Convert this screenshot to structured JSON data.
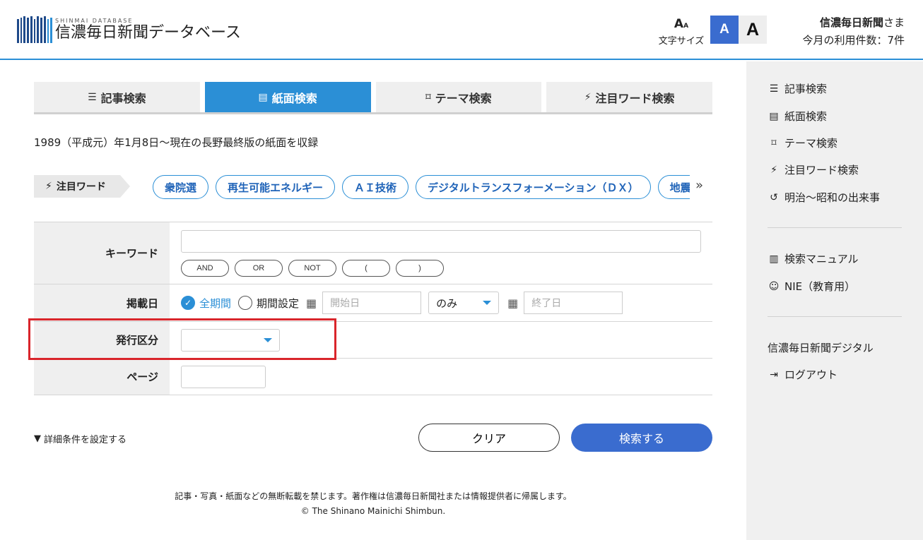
{
  "header": {
    "logo_sub": "SHINMAI DATABASE",
    "logo_main": "信濃毎日新聞データベース",
    "font_size_label": "文字サイズ",
    "font_small": "A",
    "font_large": "A",
    "user_name": "信濃毎日新聞",
    "user_suffix": "さま",
    "usage": "今月の利用件数：7件"
  },
  "tabs": [
    {
      "label": "記事検索",
      "icon": "list-icon",
      "active": false
    },
    {
      "label": "紙面検索",
      "icon": "newspaper-icon",
      "active": true
    },
    {
      "label": "テーマ検索",
      "icon": "bookmark-icon",
      "active": false
    },
    {
      "label": "注目ワード検索",
      "icon": "lightning-icon",
      "active": false
    }
  ],
  "notice": "1989（平成元）年1月8日〜現在の長野最終版の紙面を収録",
  "keywords": {
    "label": "注目ワード",
    "chips": [
      "衆院選",
      "再生可能エネルギー",
      "ＡＩ技術",
      "デジタルトランスフォーメーション（ＤＸ）",
      "地震"
    ],
    "more": "»"
  },
  "form": {
    "keyword_label": "キーワード",
    "keyword_value": "",
    "ops": [
      "AND",
      "OR",
      "NOT",
      "(",
      ")"
    ],
    "date_label": "掲載日",
    "all_period": "全期間",
    "set_period": "期間設定",
    "start_placeholder": "開始日",
    "range_option": "のみ",
    "end_placeholder": "終了日",
    "issue_label": "発行区分",
    "issue_value": "",
    "page_label": "ページ",
    "page_value": ""
  },
  "actions": {
    "detail": "詳細条件を設定する",
    "clear": "クリア",
    "search": "検索する"
  },
  "footer": {
    "line1": "記事・写真・紙面などの無断転載を禁じます。著作権は信濃毎日新聞社または情報提供者に帰属します。",
    "line2": "© The Shinano Mainichi Shimbun."
  },
  "sidebar": {
    "items": [
      {
        "label": "記事検索",
        "icon": "list-icon"
      },
      {
        "label": "紙面検索",
        "icon": "newspaper-icon"
      },
      {
        "label": "テーマ検索",
        "icon": "bookmark-icon"
      },
      {
        "label": "注目ワード検索",
        "icon": "lightning-icon"
      },
      {
        "label": "明治〜昭和の出来事",
        "icon": "history-icon"
      }
    ],
    "links": [
      {
        "label": "検索マニュアル",
        "icon": "book-icon"
      },
      {
        "label": "NIE（教育用）",
        "icon": "smile-icon"
      }
    ],
    "extra": [
      {
        "label": "信濃毎日新聞デジタル",
        "icon": ""
      },
      {
        "label": "ログアウト",
        "icon": "logout-icon"
      }
    ]
  },
  "colors": {
    "accent": "#2b8fd6",
    "button": "#3a6ccf",
    "highlight": "#d9252b"
  }
}
